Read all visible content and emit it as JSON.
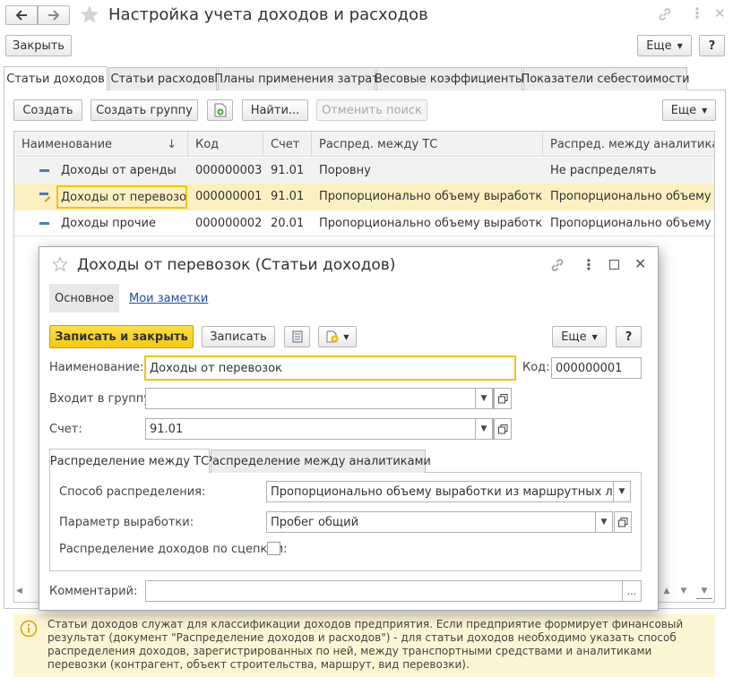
{
  "window": {
    "title": "Настройка учета доходов и расходов",
    "close_label": "Закрыть",
    "more_label": "Еще",
    "help_label": "?"
  },
  "tabs": [
    {
      "label": "Статьи доходов",
      "active": true
    },
    {
      "label": "Статьи расходов"
    },
    {
      "label": "Планы применения затрат"
    },
    {
      "label": "Весовые коэффициенты"
    },
    {
      "label": "Показатели себестоимости"
    }
  ],
  "toolbar": {
    "create_label": "Создать",
    "create_group_label": "Создать группу",
    "find_label": "Найти...",
    "cancel_search_label": "Отменить поиск",
    "more_label": "Еще"
  },
  "table": {
    "columns": [
      "Наименование",
      "Код",
      "Счет",
      "Распред. между ТС",
      "Распред. между аналитиками"
    ],
    "sort_indicator": "↓",
    "rows": [
      {
        "name": "Доходы от аренды",
        "code": "000000003",
        "account": "91.01",
        "dist_ts": "Поровну",
        "dist_analytics": "Не распределять"
      },
      {
        "name": "Доходы от перевозок",
        "code": "000000001",
        "account": "91.01",
        "dist_ts": "Пропорционально объему выработки ...",
        "dist_analytics": "Пропорционально объему ..."
      },
      {
        "name": "Доходы прочие",
        "code": "000000002",
        "account": "20.01",
        "dist_ts": "Пропорционально объему выработки ...",
        "dist_analytics": "Пропорционально объему ..."
      }
    ]
  },
  "dialog": {
    "title": "Доходы от перевозок (Статьи доходов)",
    "nav_main": "Основное",
    "nav_notes": "Мои заметки",
    "save_close_label": "Записать и закрыть",
    "save_label": "Записать",
    "more_label": "Еще",
    "help_label": "?",
    "name_label": "Наименование:",
    "name_value": "Доходы от перевозок",
    "code_label": "Код:",
    "code_value": "000000001",
    "group_label": "Входит в группу:",
    "group_value": "",
    "account_label": "Счет:",
    "account_value": "91.01",
    "inner_tabs": [
      {
        "label": "Распределение между ТС",
        "active": true
      },
      {
        "label": "Распределение между аналитиками"
      }
    ],
    "method_label": "Способ распределения:",
    "method_value": "Пропорционально объему выработки из маршрутных листов",
    "param_label": "Параметр выработки:",
    "param_value": "Пробег общий",
    "coupling_label": "Распределение доходов по сцепкам:",
    "coupling_checked": false,
    "comment_label": "Комментарий:",
    "comment_value": "",
    "comment_button": "..."
  },
  "info": {
    "text": "Статьи доходов служат для классификации доходов предприятия. Если предприятие формирует финансовый результат (документ \"Распределение доходов и расходов\") - для статьи доходов необходимо указать способ распределения доходов, зарегистрированных по ней, между транспортными средствами и аналитиками перевозки (контрагент, объект строительства, маршрут, вид перевозки)."
  },
  "colors": {
    "accent_yellow": "#f4cc1c",
    "selected_row": "#fbf0c1",
    "info_bg": "#fdf5d4",
    "link": "#1a4ea8"
  }
}
